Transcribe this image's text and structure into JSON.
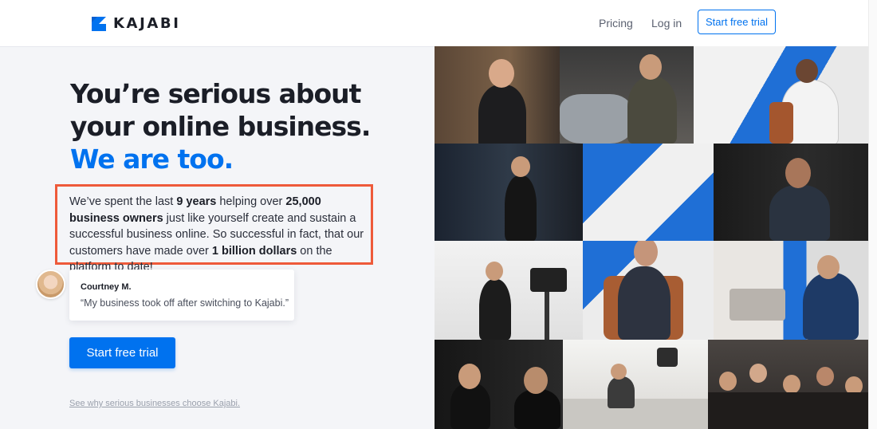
{
  "header": {
    "logo_text": "KAJABI",
    "nav": {
      "pricing": "Pricing",
      "login": "Log in",
      "trial": "Start free trial"
    }
  },
  "hero": {
    "headline_line1": "You’re serious about",
    "headline_line2": "your online business.",
    "headline_accent": "We are too.",
    "desc": {
      "p1": "We’ve spent the last ",
      "b1": "9 years",
      "p2": " helping over ",
      "b2": "25,000 business owners",
      "p3": " just like yourself create and sustain a successful business online. So successful in fact, that our customers have made over ",
      "b3": "1 billion dollars",
      "p4": " on the platform to date!"
    },
    "testimonial": {
      "name": "Courtney M.",
      "quote": "“My business took off after switching to Kajabi.”"
    },
    "cta": "Start free trial",
    "see_why": "See why serious businesses choose Kajabi."
  },
  "colors": {
    "accent": "#0072ef",
    "highlight_border": "#ee5a3a"
  },
  "icons": {
    "logo": "kajabi-logo-icon"
  }
}
